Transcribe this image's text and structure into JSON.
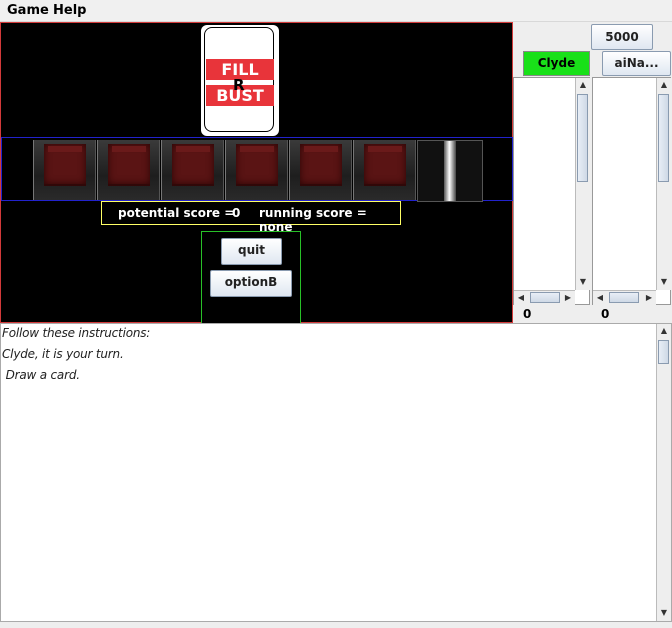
{
  "menu": {
    "items": [
      "Game",
      "Help"
    ]
  },
  "card": {
    "top_label": "FILL",
    "middle_label": "R",
    "bottom_label": "BUST",
    "band_color": "#e8343a"
  },
  "score_panel": {
    "potential_label": "potential score =",
    "potential_value": "0",
    "running_label": "running score = none"
  },
  "buttons": {
    "quit": "quit",
    "optionB": "optionB"
  },
  "right_panel": {
    "target_score": "5000",
    "players": [
      {
        "name": "Clyde",
        "active": true,
        "active_color": "#19e019",
        "score": "0"
      },
      {
        "name": "aiNa...",
        "active": false,
        "score": "0"
      }
    ]
  },
  "log": {
    "lines": [
      "Follow these instructions:",
      "Clyde, it is your turn.",
      " Draw a card."
    ]
  },
  "dice_row": {
    "red_dice_count": 6,
    "has_tube": true
  }
}
